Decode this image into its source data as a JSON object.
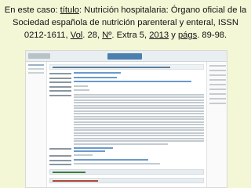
{
  "caption": {
    "intro": "En este caso: ",
    "titulo_label": "título",
    "titulo_text": ": Nutrición hospitalaria: Órgano oficial de la Sociedad española de nutrición parenteral y enteral, ISSN 0212-1611, ",
    "vol_label": "Vol",
    "vol_text": ". 28, ",
    "num_label": "Nº",
    "num_text": ". Extra 5, ",
    "year": "2013",
    "pags_pre": " y ",
    "pags_label": "págs",
    "pags_text": ". 89-98."
  }
}
